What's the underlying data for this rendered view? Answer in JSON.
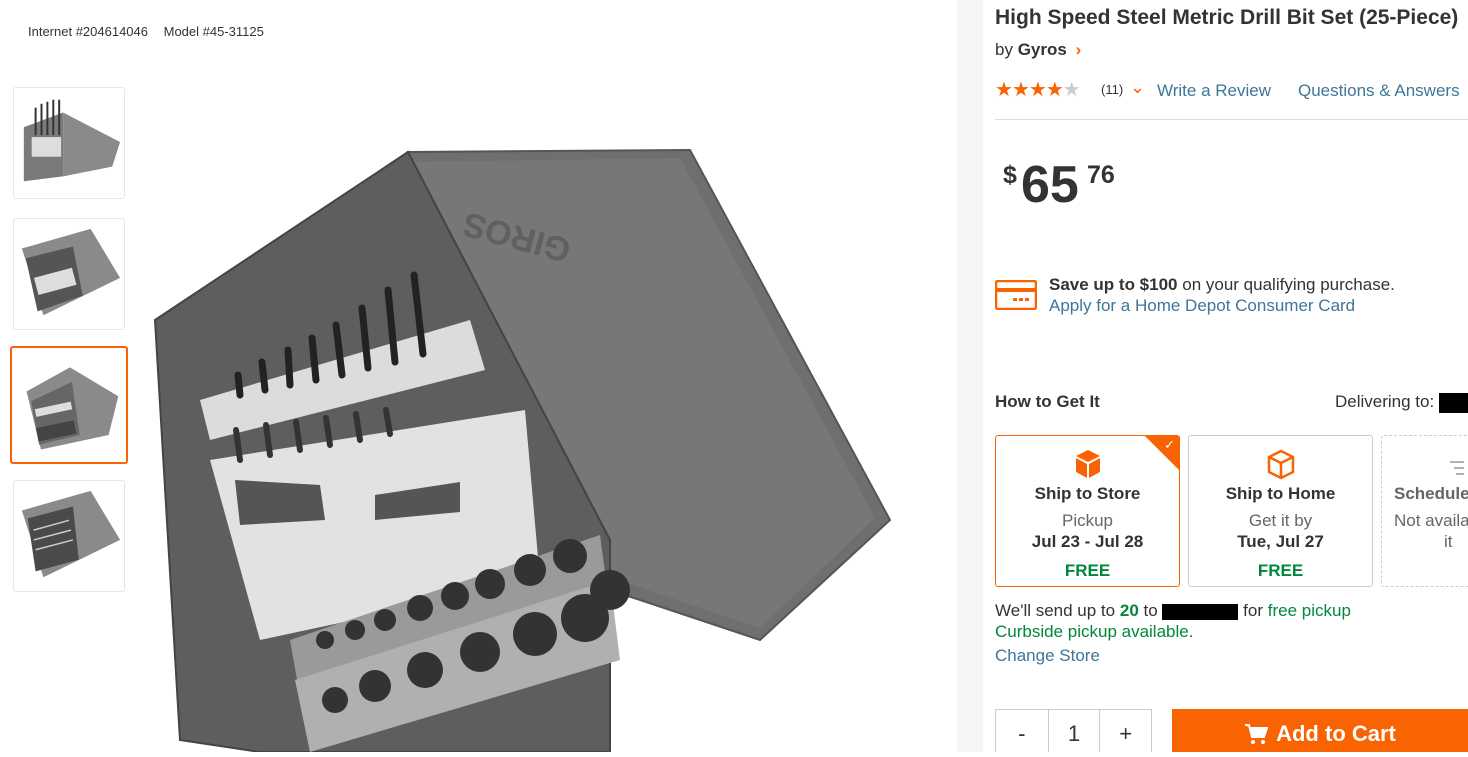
{
  "product_ids": {
    "internet": "Internet #204614046",
    "model": "Model #45-31125"
  },
  "product": {
    "title": "High Speed Steel Metric Drill Bit Set (25-Piece)",
    "by_prefix": "by",
    "brand": "Gyros",
    "rating_stars": 4,
    "rating_max": 5,
    "review_count": "(11)",
    "write_review": "Write a Review",
    "qa": "Questions & Answers"
  },
  "price": {
    "currency": "$",
    "dollars": "65",
    "cents": "76"
  },
  "promo": {
    "save_bold": "Save up to $100",
    "save_rest": "on your qualifying purchase.",
    "apply_link": "Apply for a Home Depot Consumer Card"
  },
  "fulfillment": {
    "heading": "How to Get It",
    "delivering_to": "Delivering to:",
    "options": [
      {
        "name": "Ship to Store",
        "line1": "Pickup",
        "line2": "Jul 23 - Jul 28",
        "price": "FREE",
        "selected": true,
        "icon": "store-box-icon"
      },
      {
        "name": "Ship to Home",
        "line1": "Get it by",
        "line2": "Tue, Jul 27",
        "price": "FREE",
        "selected": false,
        "icon": "home-box-icon"
      },
      {
        "name": "Schedule",
        "line1": "Not availa",
        "line2": "it",
        "selected": false,
        "icon": "calendar-icon"
      }
    ],
    "send_prefix": "We'll send up to",
    "send_count": "20",
    "send_to": "to",
    "send_for": "for",
    "send_pickup": "free pickup",
    "curbside": "Curbside pickup available.",
    "change_store": "Change Store"
  },
  "cart": {
    "minus": "-",
    "qty": "1",
    "plus": "+",
    "add_label": "Add to Cart"
  },
  "colors": {
    "accent": "#f96302",
    "link": "#3e7697",
    "green": "#00873c"
  }
}
